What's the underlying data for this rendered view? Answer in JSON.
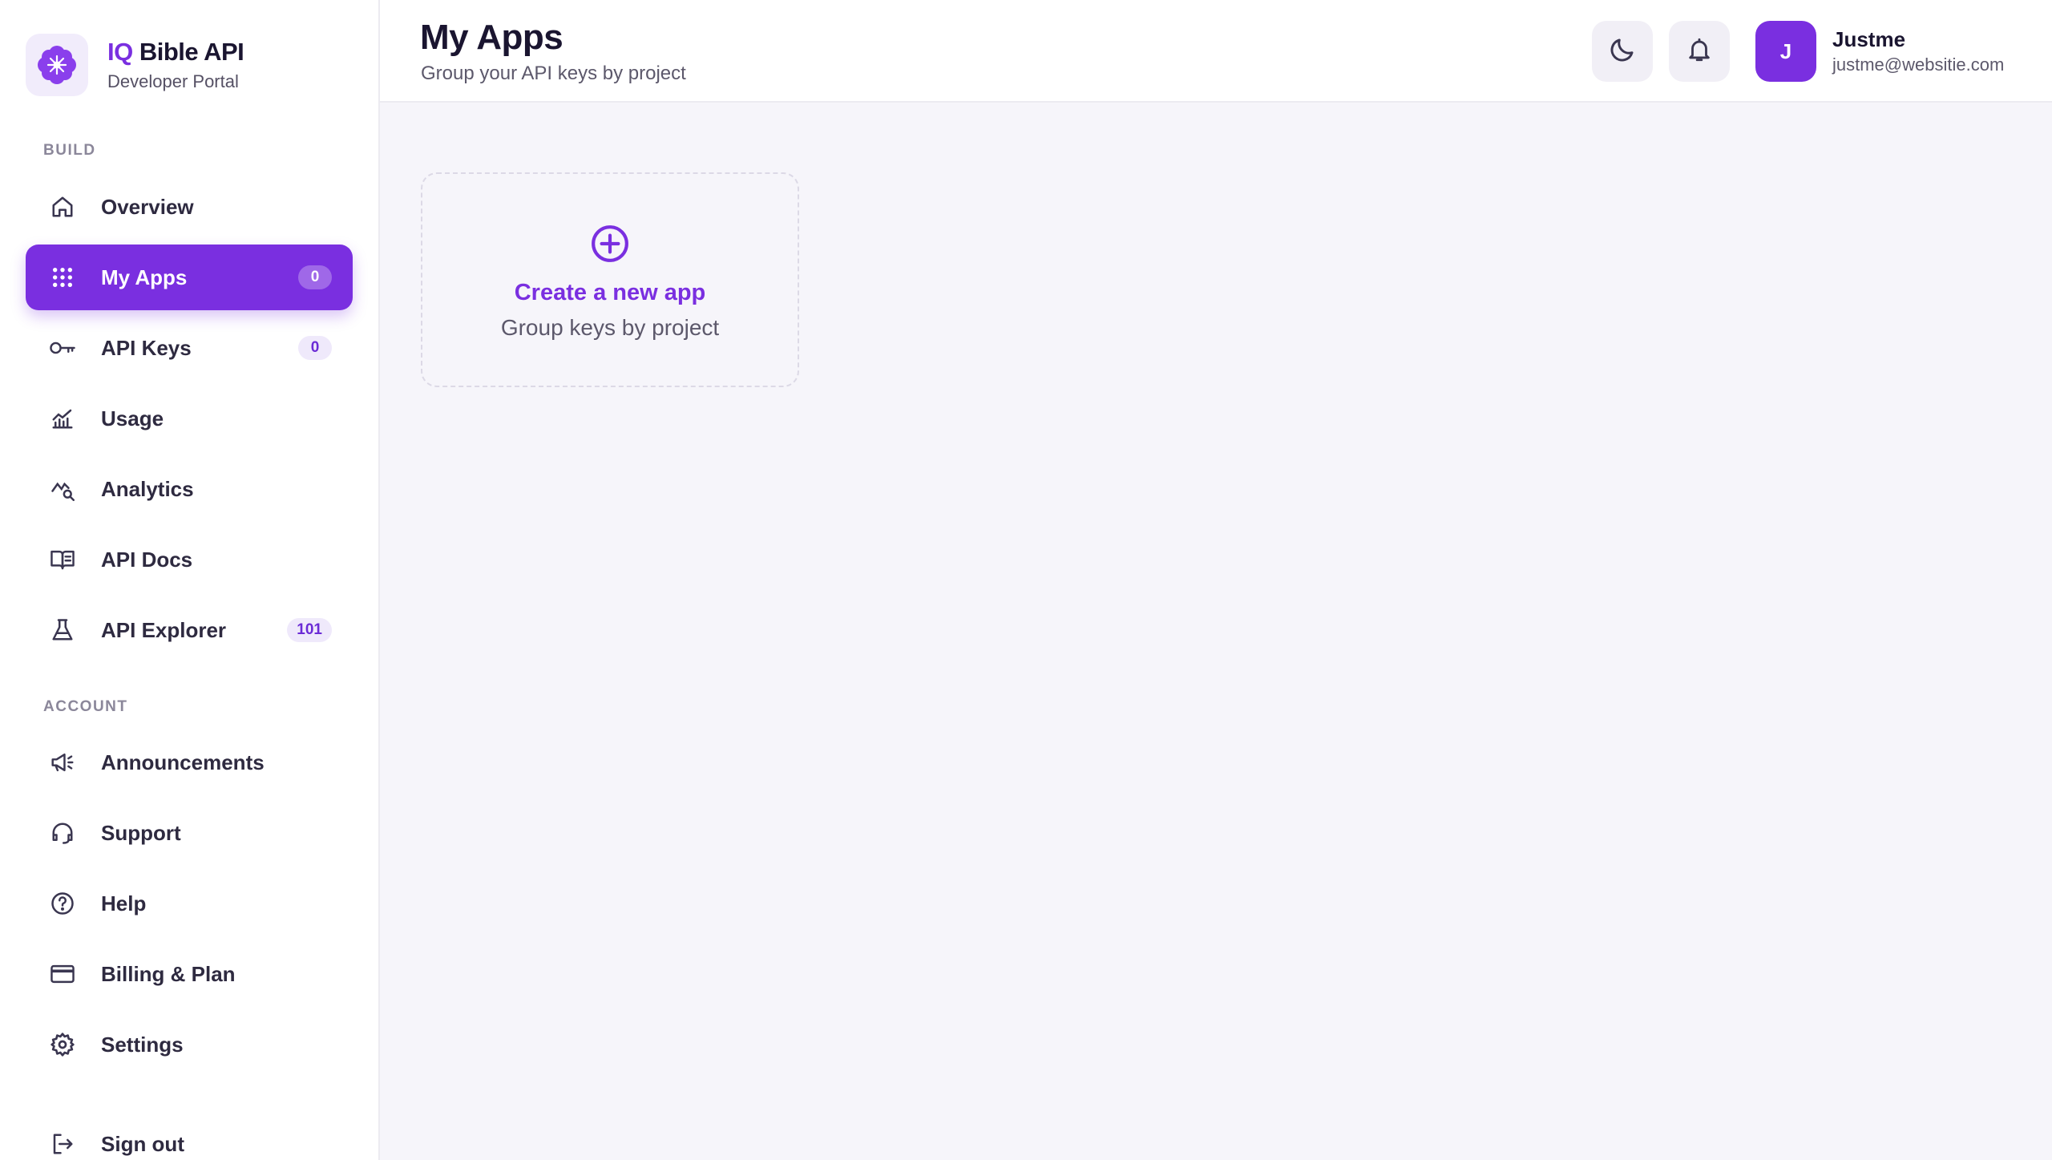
{
  "brand": {
    "title_prefix": "IQ",
    "title_rest": " Bible API",
    "subtitle": "Developer Portal"
  },
  "sidebar": {
    "build_label": "BUILD",
    "account_label": "ACCOUNT",
    "build_items": [
      {
        "label": "Overview",
        "icon": "home-icon"
      },
      {
        "label": "My Apps",
        "icon": "grid-icon",
        "badge": "0",
        "active": true
      },
      {
        "label": "API Keys",
        "icon": "key-icon",
        "badge": "0"
      },
      {
        "label": "Usage",
        "icon": "chart-icon"
      },
      {
        "label": "Analytics",
        "icon": "analytics-icon"
      },
      {
        "label": "API Docs",
        "icon": "book-icon"
      },
      {
        "label": "API Explorer",
        "icon": "flask-icon",
        "badge": "101"
      }
    ],
    "account_items": [
      {
        "label": "Announcements",
        "icon": "megaphone-icon"
      },
      {
        "label": "Support",
        "icon": "headset-icon"
      },
      {
        "label": "Help",
        "icon": "help-icon"
      },
      {
        "label": "Billing & Plan",
        "icon": "credit-card-icon"
      },
      {
        "label": "Settings",
        "icon": "gear-icon"
      },
      {
        "label": "Sign out",
        "icon": "sign-out-icon"
      }
    ]
  },
  "header": {
    "title": "My Apps",
    "subtitle": "Group your API keys by project",
    "theme_icon": "moon-icon",
    "notifications_icon": "bell-icon"
  },
  "user": {
    "initial": "J",
    "name": "Justme",
    "email": "justme@websitie.com"
  },
  "main": {
    "create_card": {
      "title": "Create a new app",
      "subtitle": "Group keys by project",
      "icon": "plus-circle-icon"
    }
  },
  "colors": {
    "accent": "#7a2fe0",
    "background": "#f6f5fa",
    "badge_bg": "#efe9fb"
  }
}
